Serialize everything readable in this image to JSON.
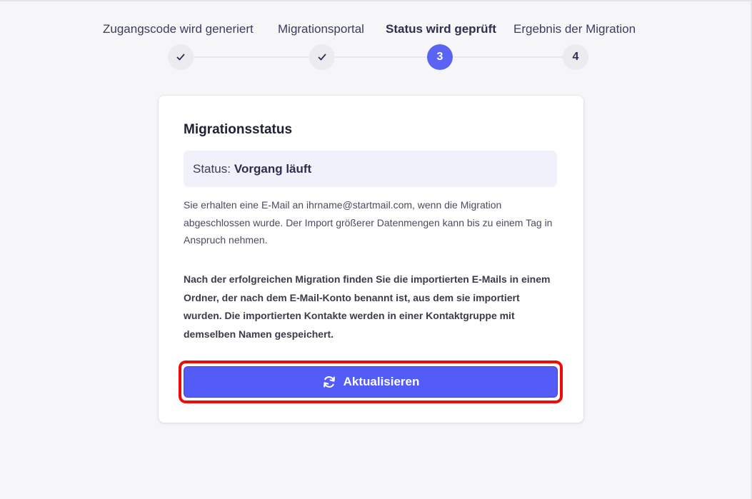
{
  "stepper": {
    "steps": [
      {
        "label": "Zugangscode wird generiert",
        "marker": "✓",
        "state": "done"
      },
      {
        "label": "Migrationsportal",
        "marker": "✓",
        "state": "done"
      },
      {
        "label": "Status wird geprüft",
        "marker": "3",
        "state": "active"
      },
      {
        "label": "Ergebnis der Migration",
        "marker": "4",
        "state": "pending"
      }
    ]
  },
  "card": {
    "title": "Migrationsstatus",
    "status_label": "Status:",
    "status_value": "Vorgang läuft",
    "paragraph1": "Sie erhalten eine E-Mail an ihrname@startmail.com, wenn die Migration abgeschlossen wurde. Der Import größerer Datenmengen kann bis zu einem Tag in Anspruch nehmen.",
    "paragraph2": "Nach der erfolgreichen Migration finden Sie die importierten E-Mails in einem Ordner, der nach dem E-Mail-Konto benannt ist, aus dem sie importiert wurden. Die importierten Kontakte werden in einer Kontaktgruppe mit demselben Namen gespeichert.",
    "refresh_button": {
      "label": "Aktualisieren",
      "icon": "refresh-icon"
    }
  },
  "colors": {
    "accent": "#545cf7",
    "active_step": "#5b63f5",
    "highlight": "#ee0a0a",
    "status_bg": "#f1f1fb"
  }
}
